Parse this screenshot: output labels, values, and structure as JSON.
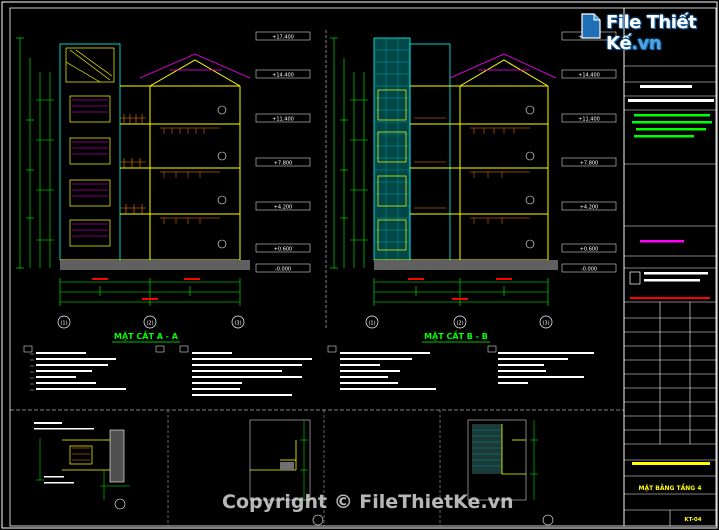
{
  "brand": {
    "logo_text": "File Thiết Kế",
    "logo_suffix": ".vn"
  },
  "watermark": "Copyright © FileThietKe.vn",
  "section_a": {
    "title": "MẶT CẮT A - A",
    "grid_bottom": [
      "(1)",
      "(2)",
      "(3)"
    ],
    "levels": [
      "+17.400",
      "+14.400",
      "+11.400",
      "+7.800",
      "+4.200",
      "+0.600",
      "-0.000"
    ]
  },
  "section_b": {
    "title": "MẶT CẮT B - B",
    "grid_bottom": [
      "(1)",
      "(2)",
      "(3)"
    ],
    "levels": [
      "+17.400",
      "+14.400",
      "+11.400",
      "+7.800",
      "+4.200",
      "+0.600",
      "-0.000"
    ]
  },
  "title_block": {
    "drawing_name": "MẶT BẰNG TẦNG 4",
    "sheet": "KT-04"
  },
  "colors": {
    "frame": "#ffffff",
    "wall": "#ffff00",
    "dimension": "#00ff00",
    "annotation": "#ff00ff",
    "section_fill": "#00a0a0",
    "label_box": "#ff0000",
    "highlight": "#00ffff"
  }
}
